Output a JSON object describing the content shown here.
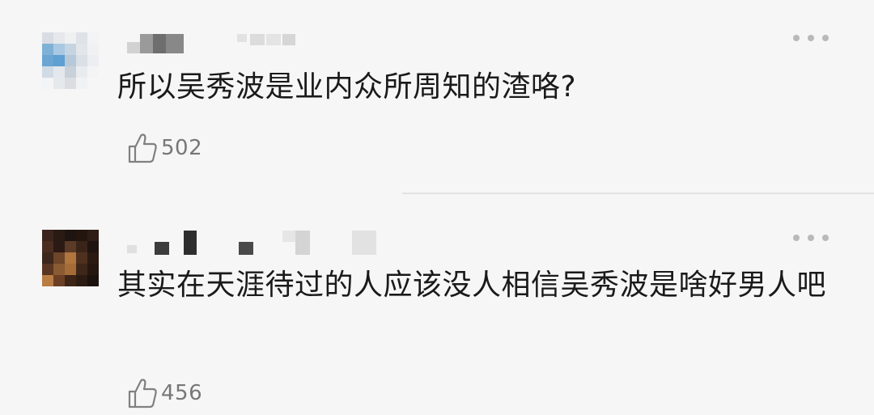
{
  "comments": [
    {
      "text": "所以吴秀波是业内众所周知的渣咯?",
      "likes": "502",
      "avatar_icon": "pixelated-avatar-blue",
      "username_icon": "blurred-username"
    },
    {
      "text": "其实在天涯待过的人应该没人相信吴秀波是啥好男人吧",
      "likes": "456",
      "avatar_icon": "pixelated-avatar-brown",
      "username_icon": "blurred-username"
    }
  ],
  "icons": {
    "like": "thumbs-up-icon",
    "more": "more-options-icon"
  },
  "colors": {
    "background": "#f6f6f6",
    "text": "#1a1a1a",
    "muted": "#777777",
    "divider": "#e3e3e3"
  }
}
